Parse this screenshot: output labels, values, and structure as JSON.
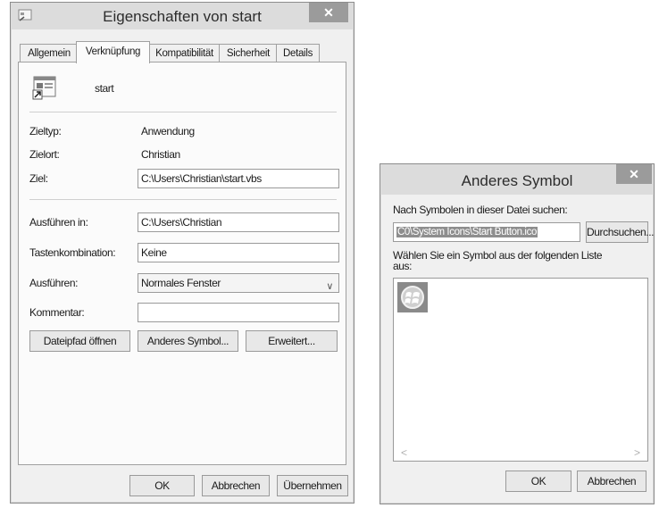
{
  "props": {
    "title": "Eigenschaften von start",
    "close": "✕",
    "tabs": [
      "Allgemein",
      "Verknüpfung",
      "Kompatibilität",
      "Sicherheit",
      "Details"
    ],
    "active_tab": "Verknüpfung",
    "shortcut_name": "start",
    "fields": {
      "zieltyp_label": "Zieltyp:",
      "zieltyp_value": "Anwendung",
      "zielort_label": "Zielort:",
      "zielort_value": "Christian",
      "ziel_label": "Ziel:",
      "ziel_value": "C:\\Users\\Christian\\start.vbs",
      "ausfuehren_in_label": "Ausführen in:",
      "ausfuehren_in_value": "C:\\Users\\Christian",
      "tasten_label": "Tastenkombination:",
      "tasten_value": "Keine",
      "ausfuehren_label": "Ausführen:",
      "ausfuehren_value": "Normales Fenster",
      "kommentar_label": "Kommentar:",
      "kommentar_value": ""
    },
    "buttons": {
      "dateipfad": "Dateipfad öffnen",
      "anderes_symbol": "Anderes Symbol...",
      "erweitert": "Erweitert...",
      "ok": "OK",
      "abbrechen": "Abbrechen",
      "uebernehmen": "Übernehmen"
    }
  },
  "symbol": {
    "title": "Anderes Symbol",
    "close": "✕",
    "search_label": "Nach Symbolen in dieser Datei suchen:",
    "file_value": "C0\\System Icons\\Start Button.ico",
    "browse": "Durchsuchen...",
    "list_label": "Wählen Sie ein Symbol aus der folgenden Liste aus:",
    "ok": "OK",
    "cancel": "Abbrechen",
    "scroll_left": "<",
    "scroll_right": ">"
  },
  "colors": {
    "titlebar": "#dcdcdc",
    "close_button": "#9b9b9b",
    "selection": "#8e8e8e"
  }
}
